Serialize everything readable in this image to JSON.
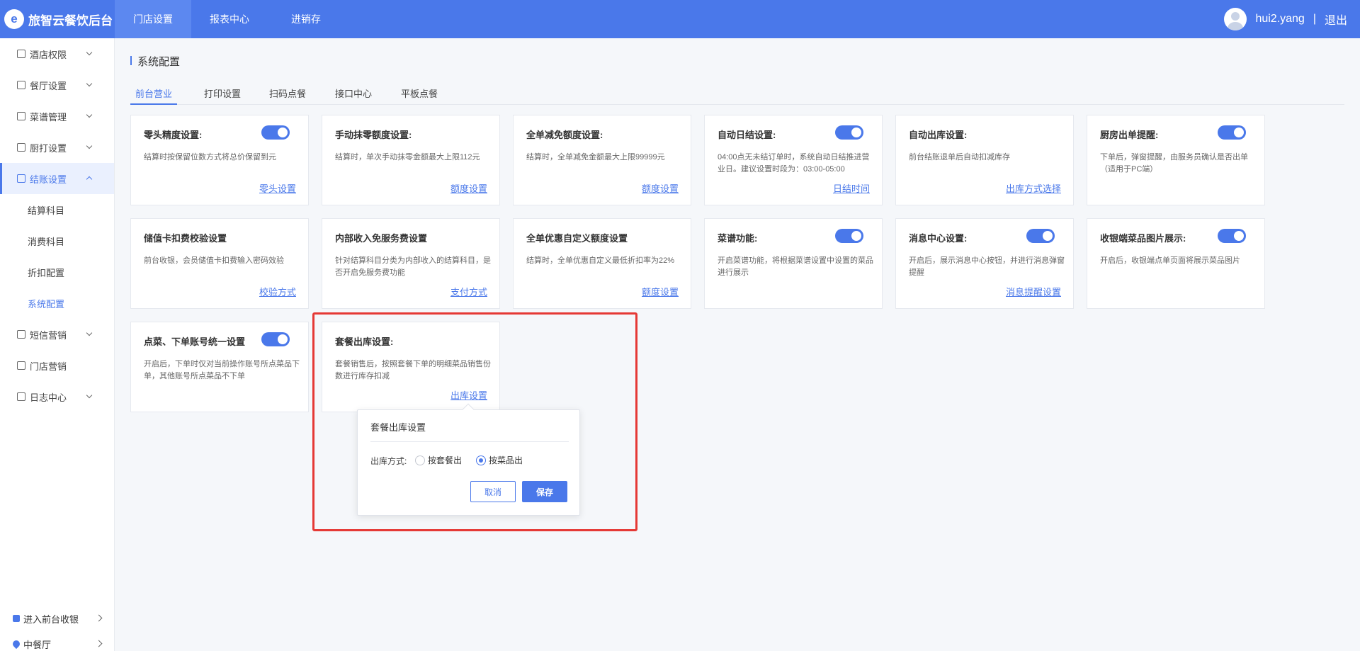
{
  "header": {
    "logo_mark": "e",
    "app_name": "旅智云餐饮后台",
    "nav": [
      {
        "label": "门店设置"
      },
      {
        "label": "报表中心"
      },
      {
        "label": "进销存"
      }
    ],
    "username": "hui2.yang",
    "separator": "|",
    "logout": "退出"
  },
  "sidebar": {
    "items": [
      {
        "label": "酒店权限"
      },
      {
        "label": "餐厅设置"
      },
      {
        "label": "菜谱管理"
      },
      {
        "label": "厨打设置"
      },
      {
        "label": "结账设置"
      },
      {
        "label": "短信营销"
      },
      {
        "label": "门店营销"
      },
      {
        "label": "日志中心"
      }
    ],
    "sub_items": [
      {
        "label": "结算科目"
      },
      {
        "label": "消费科目"
      },
      {
        "label": "折扣配置"
      },
      {
        "label": "系统配置"
      }
    ],
    "bottom": [
      {
        "label": "进入前台收银"
      },
      {
        "label": "中餐厅"
      }
    ]
  },
  "page": {
    "title": "系统配置",
    "tabs": [
      {
        "label": "前台营业"
      },
      {
        "label": "打印设置"
      },
      {
        "label": "扫码点餐"
      },
      {
        "label": "接口中心"
      },
      {
        "label": "平板点餐"
      }
    ]
  },
  "cards": [
    {
      "title": "零头精度设置:",
      "desc": "结算时按保留位数方式将总价保留到元",
      "link": "零头设置",
      "toggle_on": true
    },
    {
      "title": "手动抹零额度设置:",
      "desc": "结算时，单次手动抹零金额最大上限112元",
      "link": "额度设置",
      "toggle_on": false
    },
    {
      "title": "全单减免额度设置:",
      "desc": "结算时，全单减免金额最大上限99999元",
      "link": "额度设置",
      "toggle_on": false
    },
    {
      "title": "自动日结设置:",
      "desc": "04:00点无未结订单时，系统自动日结推进营业日。建议设置时段为：03:00-05:00",
      "link": "日结时间",
      "toggle_on": true
    },
    {
      "title": "自动出库设置:",
      "desc": "前台结账退单后自动扣减库存",
      "link": "出库方式选择",
      "toggle_on": false
    },
    {
      "title": "厨房出单提醒:",
      "desc": "下单后，弹窗提醒，由服务员确认是否出单（适用于PC端）",
      "link": "",
      "toggle_on": true
    },
    {
      "title": "储值卡扣费校验设置",
      "desc": "前台收银，会员储值卡扣费输入密码效验",
      "link": "校验方式",
      "toggle_on": false
    },
    {
      "title": "内部收入免服务费设置",
      "desc": "针对结算科目分类为内部收入的结算科目，是否开启免服务费功能",
      "link": "支付方式",
      "toggle_on": false
    },
    {
      "title": "全单优惠自定义额度设置",
      "desc": "结算时，全单优惠自定义最低折扣率为22%",
      "link": "额度设置",
      "toggle_on": false
    },
    {
      "title": "菜谱功能:",
      "desc": "开启菜谱功能，将根据菜谱设置中设置的菜品进行展示",
      "link": "",
      "toggle_on": true
    },
    {
      "title": "消息中心设置:",
      "desc": "开启后，展示消息中心按钮，并进行消息弹窗提醒",
      "link": "消息提醒设置",
      "toggle_on": true
    },
    {
      "title": "收银端菜品图片展示:",
      "desc": "开启后，收银端点单页面将展示菜品图片",
      "link": "",
      "toggle_on": true
    },
    {
      "title": "点菜、下单账号统一设置",
      "desc": "开启后，下单时仅对当前操作账号所点菜品下单，其他账号所点菜品不下单",
      "link": "",
      "toggle_on": true
    },
    {
      "title": "套餐出库设置:",
      "desc": "套餐销售后，按照套餐下单的明细菜品销售份数进行库存扣减",
      "link": "出库设置",
      "toggle_on": false
    }
  ],
  "popover": {
    "title": "套餐出库设置",
    "label": "出库方式:",
    "options": [
      {
        "label": "按套餐出",
        "selected": false
      },
      {
        "label": "按菜品出",
        "selected": true
      }
    ],
    "cancel": "取消",
    "save": "保存"
  },
  "colors": {
    "primary": "#4a78ea",
    "highlight": "#e53935"
  }
}
